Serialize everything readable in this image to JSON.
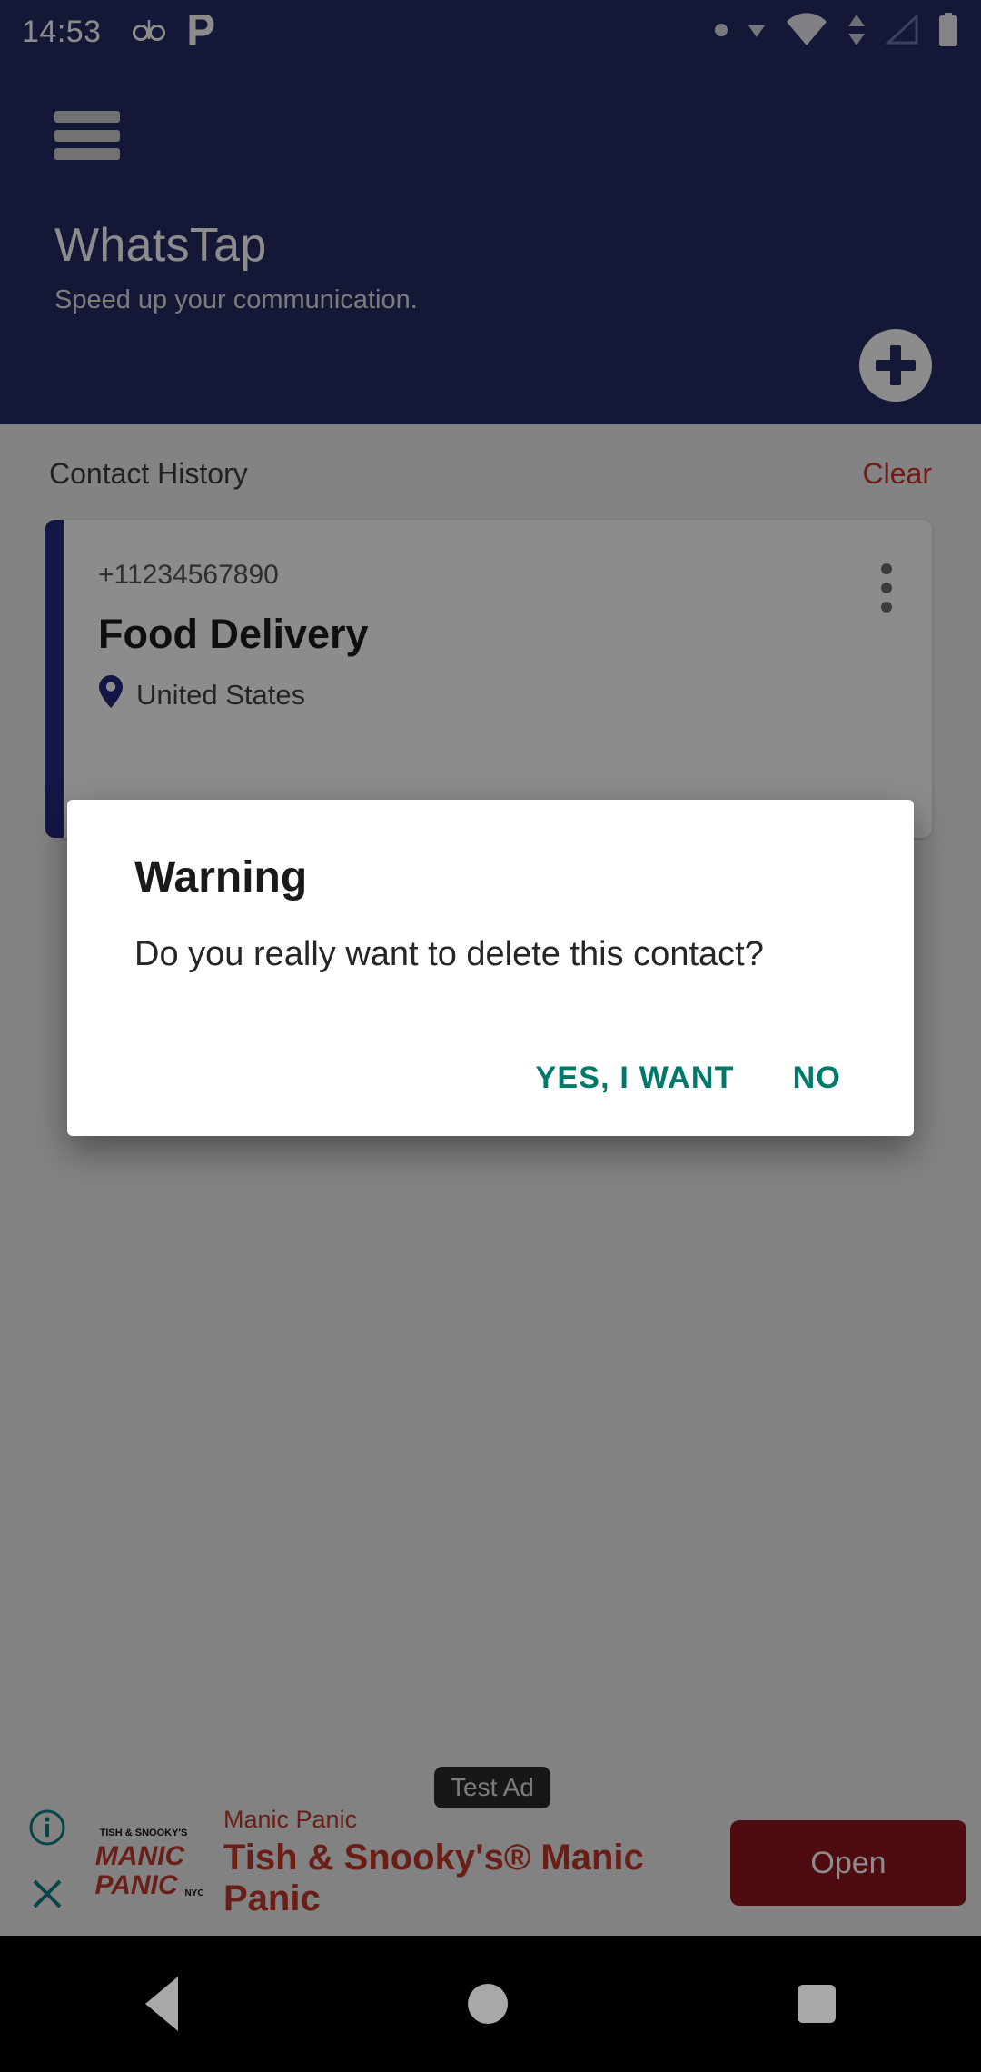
{
  "statusbar": {
    "time": "14:53",
    "left_icons": [
      "voicemail-icon",
      "app-p-icon"
    ],
    "right_icons": [
      "dot-icon",
      "small-triangle-icon",
      "wifi-icon",
      "data-transfer-icon",
      "signal-icon",
      "battery-icon"
    ]
  },
  "appbar": {
    "menu_icon": "hamburger-icon",
    "title": "WhatsTap",
    "subtitle": "Speed up your communication.",
    "add_icon": "plus-icon",
    "background_color": "#262a63"
  },
  "content": {
    "section_title": "Contact History",
    "clear_label": "Clear",
    "clear_color": "#d32f2f",
    "contacts": [
      {
        "phone": "+11234567890",
        "name": "Food Delivery",
        "country": "United States",
        "location_icon": "map-pin-icon",
        "menu_icon": "three-dot-menu-icon",
        "accent_color": "#262a7f"
      }
    ]
  },
  "dialog": {
    "title": "Warning",
    "message": "Do you really want to delete this contact?",
    "confirm_label": "YES, I WANT",
    "cancel_label": "NO",
    "button_color": "#00796b"
  },
  "ad": {
    "badge": "Test Ad",
    "advertiser": "Manic Panic",
    "headline": "Tish & Snooky's® Manic Panic",
    "cta_label": "Open",
    "cta_color": "#8e1620",
    "info_icon": "info-circle-icon",
    "close_icon": "close-x-icon",
    "logo_line1": "TISH & SNOOKY'S",
    "logo_line2": "MANIC",
    "logo_line3": "PANIC",
    "logo_line4": "NYC"
  },
  "navbar": {
    "back": "back-triangle-icon",
    "home": "home-circle-icon",
    "recents": "recents-square-icon"
  }
}
